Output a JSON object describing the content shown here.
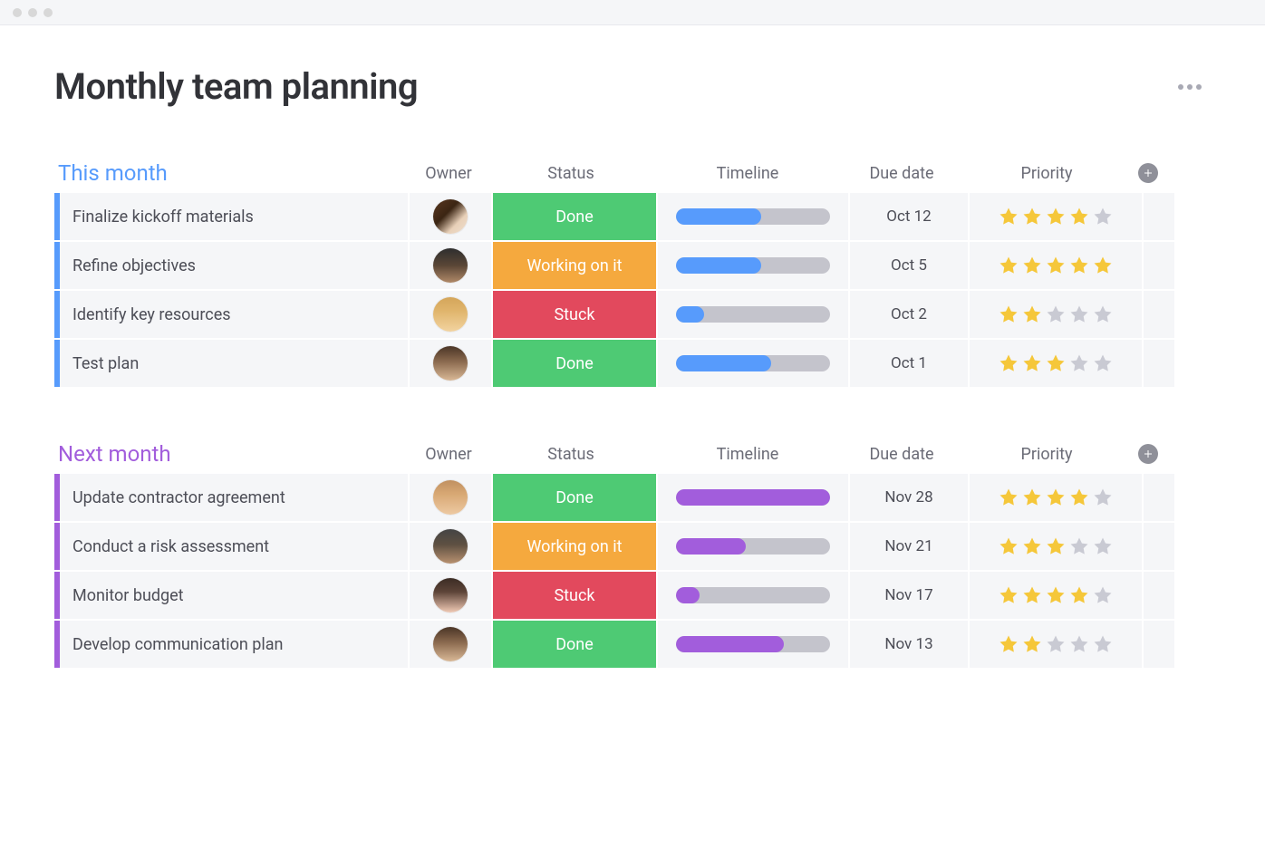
{
  "page_title": "Monthly team planning",
  "columns": {
    "owner": "Owner",
    "status": "Status",
    "timeline": "Timeline",
    "due_date": "Due date",
    "priority": "Priority"
  },
  "status_colors": {
    "Done": "#4eca74",
    "Working on it": "#f5a93e",
    "Stuck": "#e2495d"
  },
  "groups": [
    {
      "id": "this",
      "title": "This month",
      "accent": "#579bfc",
      "rows": [
        {
          "task": "Finalize kickoff materials",
          "owner_avatar": "avatar-1",
          "status": "Done",
          "timeline_pct": 55,
          "due_date": "Oct 12",
          "priority": 4
        },
        {
          "task": "Refine objectives",
          "owner_avatar": "avatar-2",
          "status": "Working on it",
          "timeline_pct": 55,
          "due_date": "Oct 5",
          "priority": 5
        },
        {
          "task": "Identify key resources",
          "owner_avatar": "avatar-3",
          "status": "Stuck",
          "timeline_pct": 18,
          "due_date": "Oct 2",
          "priority": 2
        },
        {
          "task": "Test plan",
          "owner_avatar": "avatar-4",
          "status": "Done",
          "timeline_pct": 62,
          "due_date": "Oct 1",
          "priority": 3
        }
      ]
    },
    {
      "id": "next",
      "title": "Next month",
      "accent": "#a25ddc",
      "rows": [
        {
          "task": "Update contractor agreement",
          "owner_avatar": "avatar-5",
          "status": "Done",
          "timeline_pct": 100,
          "due_date": "Nov 28",
          "priority": 4
        },
        {
          "task": "Conduct a risk assessment",
          "owner_avatar": "avatar-6",
          "status": "Working on it",
          "timeline_pct": 45,
          "due_date": "Nov 21",
          "priority": 3
        },
        {
          "task": "Monitor budget",
          "owner_avatar": "avatar-7",
          "status": "Stuck",
          "timeline_pct": 15,
          "due_date": "Nov 17",
          "priority": 4
        },
        {
          "task": "Develop communication plan",
          "owner_avatar": "avatar-8",
          "status": "Done",
          "timeline_pct": 70,
          "due_date": "Nov 13",
          "priority": 2
        }
      ]
    }
  ],
  "avatars": {
    "avatar-1": "linear-gradient(135deg,#5a3821 0%,#3b2513 40%,#e8d0b8 70%,#f0e0d0 100%)",
    "avatar-2": "linear-gradient(180deg,#2e2e2e 0%,#5a4636 50%,#b08968 100%)",
    "avatar-3": "linear-gradient(180deg,#d4a55a 0%,#e0b56c 40%,#f2d3a0 100%)",
    "avatar-4": "linear-gradient(180deg,#4a3526 0%,#8b6a4f 45%,#d9b896 100%)",
    "avatar-5": "linear-gradient(180deg,#c09060 0%,#d8a874 40%,#edc9a2 100%)",
    "avatar-6": "linear-gradient(180deg,#444444 0%,#5e5042 45%,#b89170 100%)",
    "avatar-7": "linear-gradient(180deg,#3b2c24 0%,#5d4438 40%,#f1cab5 100%)",
    "avatar-8": "linear-gradient(180deg,#4a3526 0%,#8b6a4f 45%,#d9b896 100%)"
  }
}
